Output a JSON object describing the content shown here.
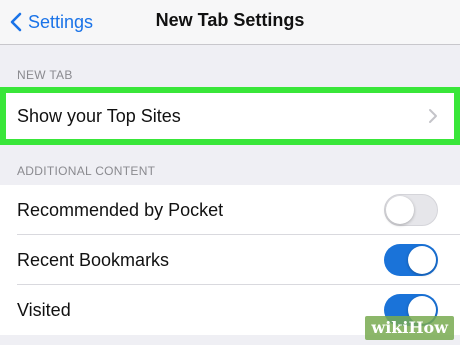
{
  "navbar": {
    "back_label": "Settings",
    "title": "New Tab Settings"
  },
  "sections": {
    "new_tab_header": "NEW TAB",
    "additional_header": "ADDITIONAL CONTENT"
  },
  "rows": {
    "top_sites": {
      "label": "Show your Top Sites",
      "icon": "chevron-right-icon"
    },
    "pocket": {
      "label": "Recommended by Pocket",
      "toggle_on": false
    },
    "bookmarks": {
      "label": "Recent Bookmarks",
      "toggle_on": true
    },
    "visited": {
      "label": "Visited",
      "toggle_on": true
    }
  },
  "highlight_color": "#39e639",
  "accent_color": "#1a73e8",
  "watermark": {
    "text": "wikiHow"
  }
}
